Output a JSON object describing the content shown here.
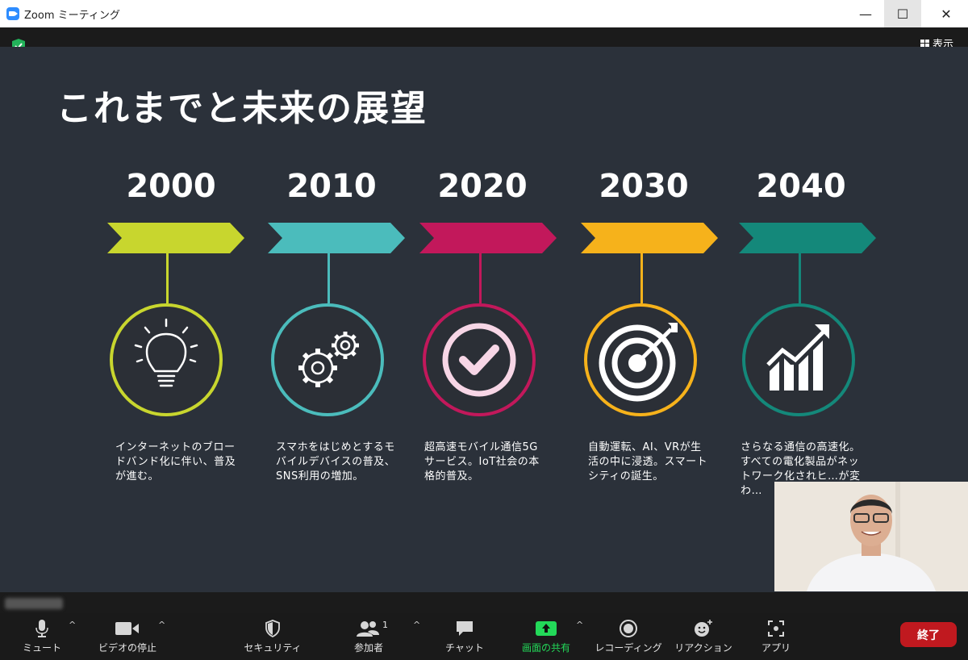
{
  "window": {
    "title": "Zoom ミーティング",
    "minimize": "—",
    "maximize": "☐",
    "close": "✕"
  },
  "view_button": {
    "label": "表示"
  },
  "slide": {
    "title": "これまでと未来の展望",
    "milestones": [
      {
        "year": "2000",
        "color": "#c8d62e",
        "icon": "lightbulb-icon",
        "text": "インターネットのブロードバンド化に伴い、普及が進む。"
      },
      {
        "year": "2010",
        "color": "#4bbcbc",
        "icon": "gears-icon",
        "text": "スマホをはじめとするモバイルデバイスの普及、SNS利用の増加。"
      },
      {
        "year": "2020",
        "color": "#c2185b",
        "icon": "checkmark-icon",
        "text": "超高速モバイル通信5Gサービス。IoT社会の本格的普及。"
      },
      {
        "year": "2030",
        "color": "#f6b21b",
        "icon": "target-icon",
        "text": "自動運転、AI、VRが生活の中に浸透。スマートシティの誕生。"
      },
      {
        "year": "2040",
        "color": "#14887a",
        "icon": "growth-chart-icon",
        "text": "さらなる通信の高速化。すべての電化製品がネットワーク化されヒ…が変わ…"
      }
    ]
  },
  "toolbar": {
    "mute": "ミュート",
    "video": "ビデオの停止",
    "security": "セキュリティ",
    "participants": "参加者",
    "participants_count": "1",
    "chat": "チャット",
    "share": "画面の共有",
    "record": "レコーディング",
    "reactions": "リアクション",
    "apps": "アプリ",
    "end": "終了",
    "caret": "^"
  },
  "colors": {
    "share_green": "#23d959",
    "end_red": "#c0191f",
    "slide_bg": "#2b313a"
  }
}
